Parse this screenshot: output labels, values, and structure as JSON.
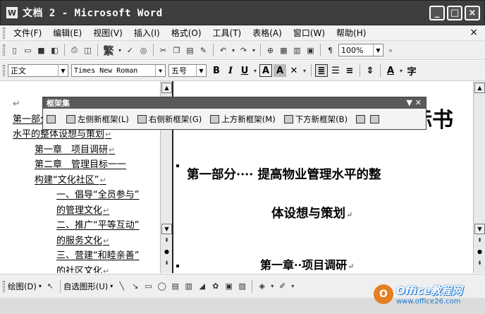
{
  "window": {
    "title": "文档 2 - Microsoft Word",
    "buttons": [
      "_",
      "□",
      "×"
    ]
  },
  "menubar": {
    "items": [
      "文件(F)",
      "编辑(E)",
      "视图(V)",
      "插入(I)",
      "格式(O)",
      "工具(T)",
      "表格(A)",
      "窗口(W)",
      "帮助(H)"
    ],
    "close": "×"
  },
  "standard_toolbar": {
    "traditional": "繁",
    "zoom": "100%"
  },
  "format_toolbar": {
    "style": "正文",
    "font": "Times New Roman",
    "size": "五号",
    "bold": "B",
    "italic": "I",
    "underline": "U",
    "charborder": "A",
    "charshade": "A"
  },
  "toc": {
    "items": [
      {
        "text": "↵",
        "level": 1
      },
      {
        "text": "第一部分　提高物业管理",
        "level": 1
      },
      {
        "text": "水平的整体设想与策划",
        "level": 1
      },
      {
        "text": "第一章　项目调研",
        "level": 2
      },
      {
        "text": "第二章　管理目标一一",
        "level": 2
      },
      {
        "text": "构建“文化社区”",
        "level": 2
      },
      {
        "text": "一、倡导“全员参与”",
        "level": 3
      },
      {
        "text": "的管理文化",
        "level": 3
      },
      {
        "text": "二、推广“平等互动”",
        "level": 3
      },
      {
        "text": "的服务文化",
        "level": 3
      },
      {
        "text": "三、营建“和睦亲善”",
        "level": 3
      },
      {
        "text": "的社区文化",
        "level": 3
      }
    ]
  },
  "frames_toolbar": {
    "title": "框架集",
    "buttons": [
      "左侧新框架(L)",
      "右侧新框架(G)",
      "上方新框架(M)",
      "下方新框架(B)"
    ]
  },
  "document": {
    "big_title_fragment": "标书",
    "heading1_line1": "第一部分···· 提高物业管理水平的整",
    "heading1_line2": "体设想与策划",
    "heading2": "第一章··项目调研"
  },
  "drawing_toolbar": {
    "draw": "绘图(D)",
    "autoshapes": "自选图形(U)"
  },
  "watermark": {
    "brand": "Office教程网",
    "site": "www.office26.com"
  }
}
